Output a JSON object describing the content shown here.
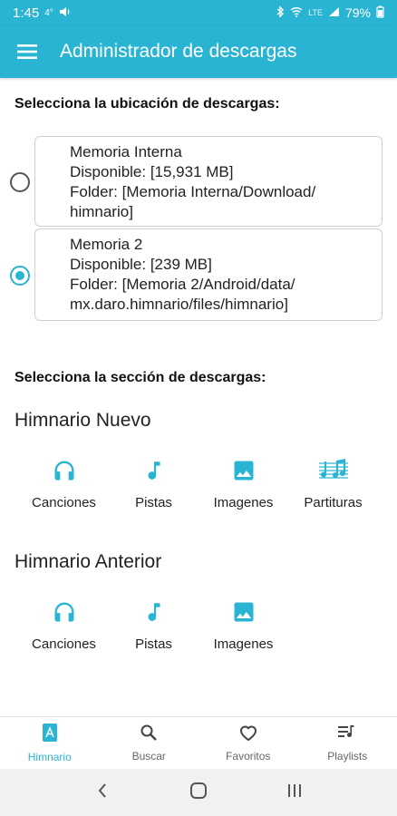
{
  "status_bar": {
    "time": "1:45",
    "temp": "4°",
    "signal_text": "LTE",
    "battery": "79%"
  },
  "app_bar": {
    "title": "Administrador de descargas"
  },
  "location_section": {
    "label": "Selecciona la ubicación de descargas:",
    "options": [
      {
        "lines": [
          "Memoria Interna",
          "Disponible: [15,931 MB]",
          "Folder: [Memoria Interna/Download/",
          "himnario]"
        ],
        "selected": false
      },
      {
        "lines": [
          "Memoria 2",
          "Disponible: [239 MB]",
          "Folder: [Memoria 2/Android/data/",
          "mx.daro.himnario/files/himnario]"
        ],
        "selected": true
      }
    ]
  },
  "downloads_section": {
    "label": "Selecciona la sección de descargas:",
    "groups": [
      {
        "title": "Himnario Nuevo",
        "items": [
          {
            "label": "Canciones",
            "icon": "headphones-icon"
          },
          {
            "label": "Pistas",
            "icon": "music-note-icon"
          },
          {
            "label": "Imagenes",
            "icon": "image-icon"
          },
          {
            "label": "Partituras",
            "icon": "sheet-music-icon"
          }
        ]
      },
      {
        "title": "Himnario Anterior",
        "items": [
          {
            "label": "Canciones",
            "icon": "headphones-icon"
          },
          {
            "label": "Pistas",
            "icon": "music-note-icon"
          },
          {
            "label": "Imagenes",
            "icon": "image-icon"
          }
        ]
      }
    ]
  },
  "bottom_nav": {
    "items": [
      {
        "label": "Himnario",
        "icon": "book-icon",
        "active": true
      },
      {
        "label": "Buscar",
        "icon": "search-icon",
        "active": false
      },
      {
        "label": "Favoritos",
        "icon": "heart-icon",
        "active": false
      },
      {
        "label": "Playlists",
        "icon": "playlist-icon",
        "active": false
      }
    ]
  },
  "colors": {
    "accent": "#2ab4d4",
    "text": "#222222",
    "nav_inactive": "#666666"
  }
}
